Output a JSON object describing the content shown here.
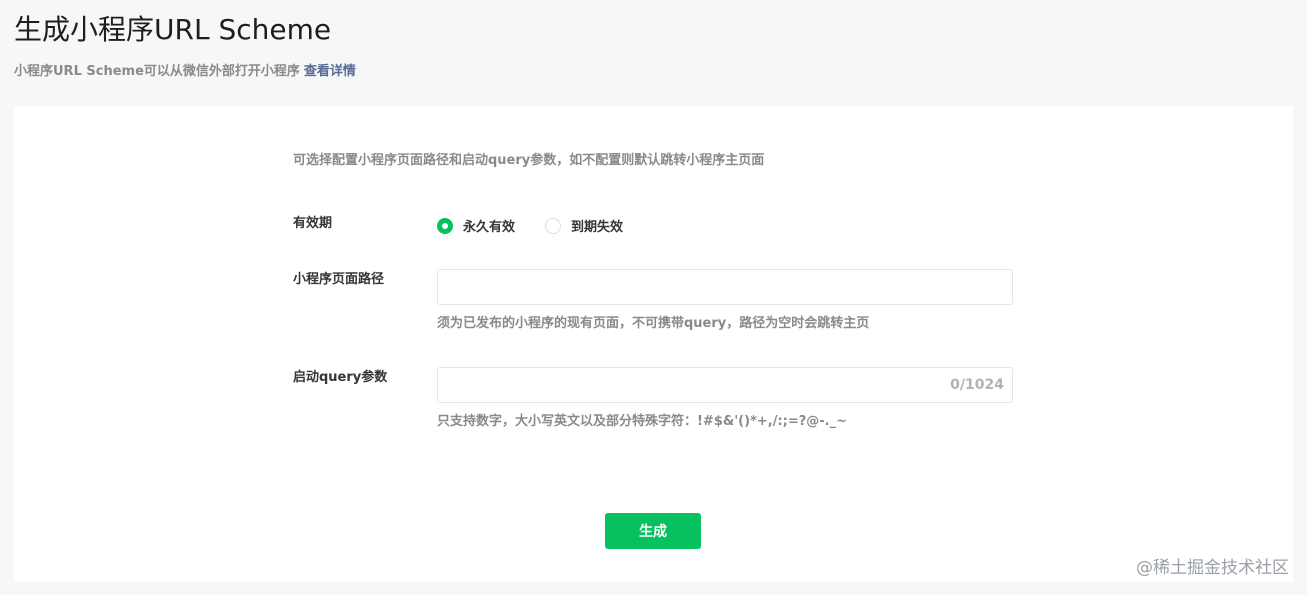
{
  "page": {
    "title": "生成小程序URL Scheme",
    "subtitle": "小程序URL Scheme可以从微信外部打开小程序",
    "details_link": "查看详情"
  },
  "form": {
    "hint": "可选择配置小程序页面路径和启动query参数，如不配置则默认跳转小程序主页面",
    "validity": {
      "label": "有效期",
      "options": [
        {
          "label": "永久有效",
          "checked": true
        },
        {
          "label": "到期失效",
          "checked": false
        }
      ]
    },
    "path": {
      "label": "小程序页面路径",
      "value": "",
      "tip": "须为已发布的小程序的现有页面，不可携带query，路径为空时会跳转主页"
    },
    "query": {
      "label": "启动query参数",
      "value": "",
      "counter": "0/1024",
      "tip": "只支持数字，大小写英文以及部分特殊字符：!#$&'()*+,/:;=?@-._~"
    },
    "generate_label": "生成"
  },
  "watermark": "@稀土掘金技术社区",
  "colors": {
    "accent": "#07c160",
    "link": "#576b95",
    "background": "#f6f7f9"
  }
}
